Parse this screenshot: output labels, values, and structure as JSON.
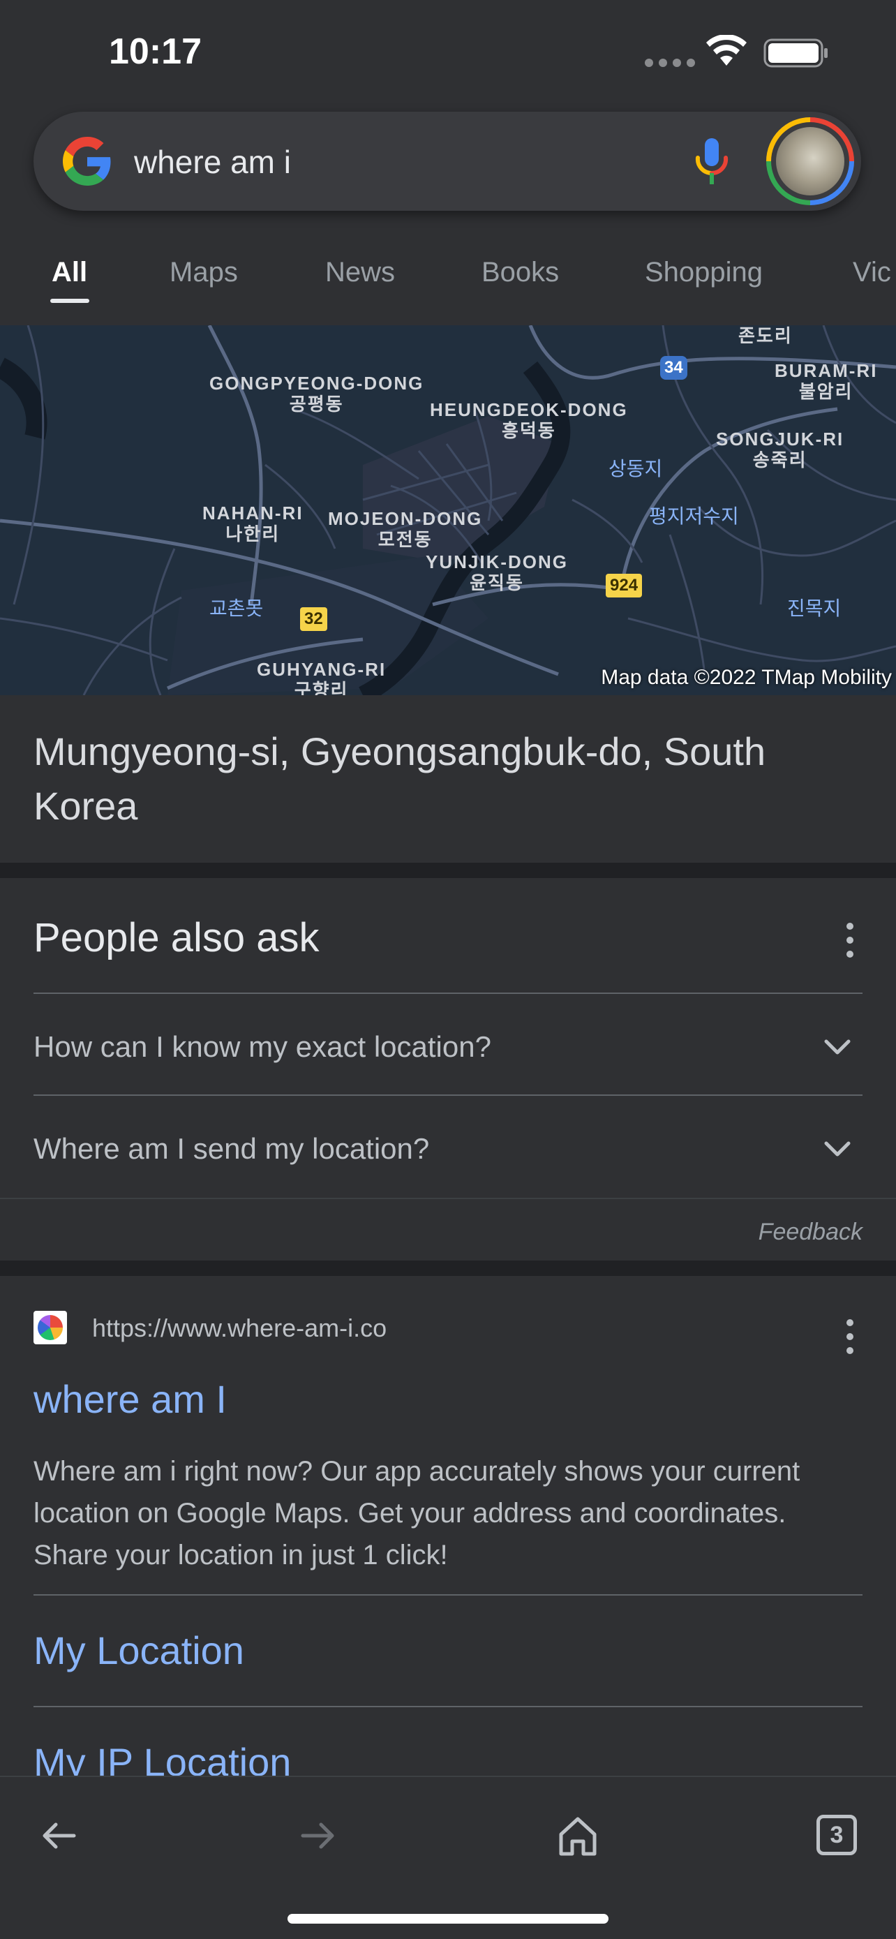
{
  "status_bar": {
    "time": "10:17"
  },
  "search": {
    "query": "where am i"
  },
  "tabs": [
    {
      "label": "All",
      "active": true
    },
    {
      "label": "Maps"
    },
    {
      "label": "News"
    },
    {
      "label": "Books"
    },
    {
      "label": "Shopping"
    },
    {
      "label": "Vic"
    }
  ],
  "map": {
    "labels": {
      "gongpyeong_en": "GONGPYEONG-DONG",
      "gongpyeong_ko": "공평동",
      "heungdeok_en": "HEUNGDEOK-DONG",
      "heungdeok_ko": "흥덕동",
      "jondo_ko": "존도리",
      "buram_en": "BURAM-RI",
      "buram_ko": "불암리",
      "songjuk_en": "SONGJUK-RI",
      "songjuk_ko": "송죽리",
      "sangdongji": "상동지",
      "pyeongji": "평지저수지",
      "nahan_en": "NAHAN-RI",
      "nahan_ko": "나한리",
      "mojeon_en": "MOJEON-DONG",
      "mojeon_ko": "모전동",
      "yunjik_en": "YUNJIK-DONG",
      "yunjik_ko": "윤직동",
      "gyochon": "교촌못",
      "jinmokji": "진목지",
      "guhyang_en": "GUHYANG-RI",
      "guhyang_ko": "구향리"
    },
    "route_shields": {
      "r34": "34",
      "r32": "32",
      "r924": "924"
    },
    "attribution": "Map data ©2022 TMap Mobility"
  },
  "location": {
    "text": "Mungyeong-si, Gyeongsangbuk-do, South Korea"
  },
  "people_also_ask": {
    "title": "People also ask",
    "questions": [
      "How can I know my exact location?",
      "Where am I send my location?"
    ],
    "feedback": "Feedback"
  },
  "result": {
    "url": "https://www.where-am-i.co",
    "title": "where am I",
    "snippet": "Where am i right now? Our app accurately shows your current location on Google Maps. Get your address and coordinates. Share your location in just 1 click!",
    "sitelinks": [
      "My Location",
      "My IP Location"
    ]
  },
  "bottom_bar": {
    "tab_count": "3"
  },
  "colors": {
    "background": "#202124",
    "surface": "#2f3033",
    "link": "#8ab4f8",
    "map_water": "#1e2c3a"
  }
}
